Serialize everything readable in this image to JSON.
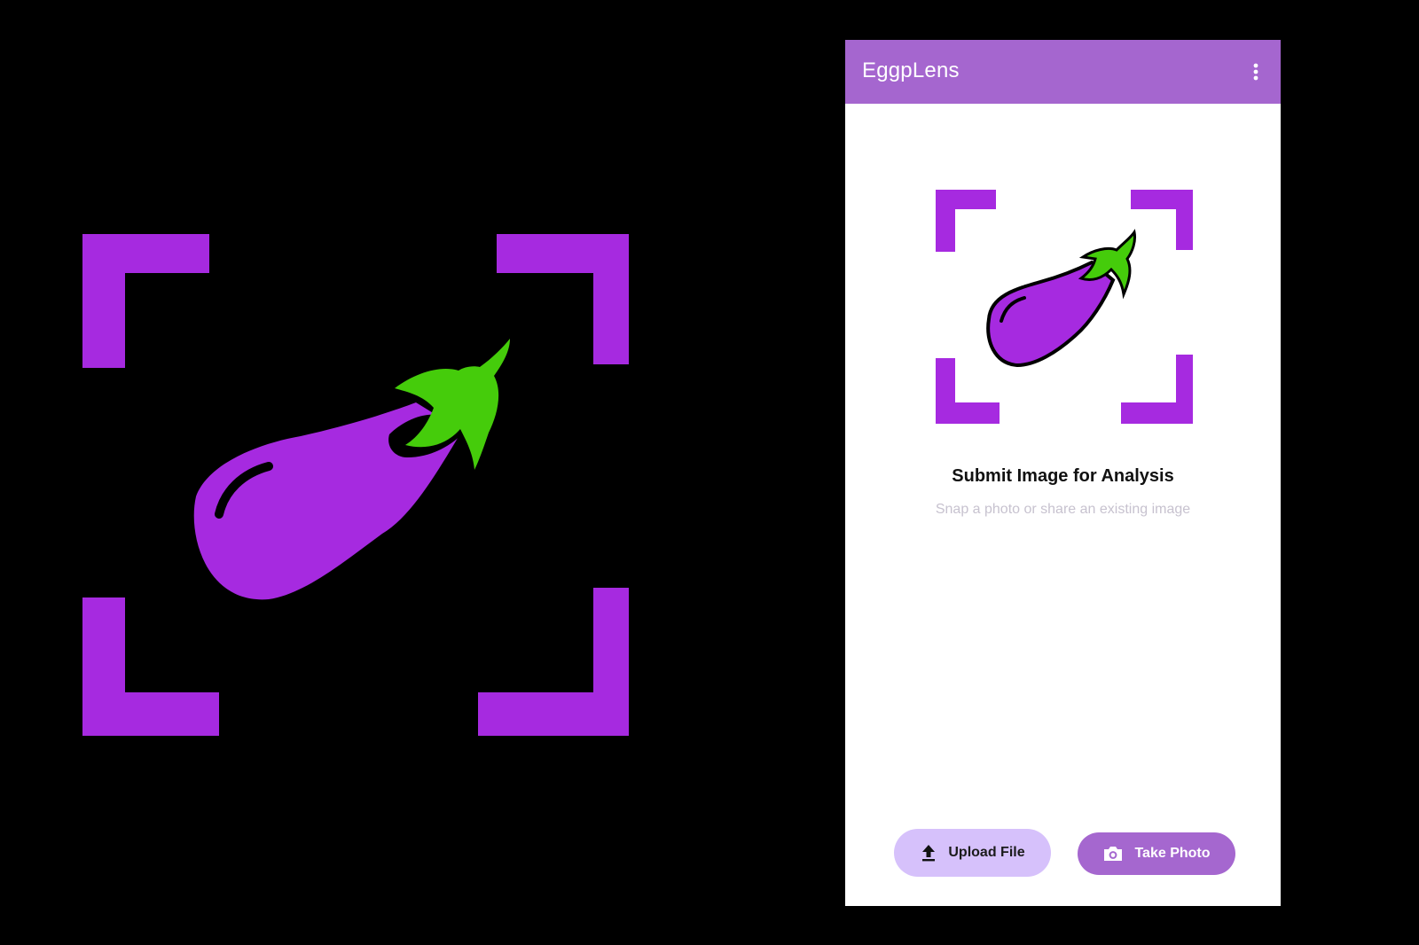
{
  "app": {
    "title": "EggpLens"
  },
  "colors": {
    "app_bar": "#a566cf",
    "brand_purple": "#a62ae0",
    "leaf_green": "#45cc0b",
    "upload_button_bg": "#d6c1fb",
    "photo_button_bg": "#a567cf",
    "subtitle_text": "#c7c2cf"
  },
  "icons": {
    "menu": "more-vert-icon",
    "logo": "eggplant-scan-icon",
    "upload": "upload-icon",
    "camera": "camera-icon"
  },
  "main": {
    "headline": "Submit Image for Analysis",
    "subline": "Snap a photo or share an existing image"
  },
  "actions": {
    "upload_label": "Upload File",
    "photo_label": "Take Photo"
  }
}
